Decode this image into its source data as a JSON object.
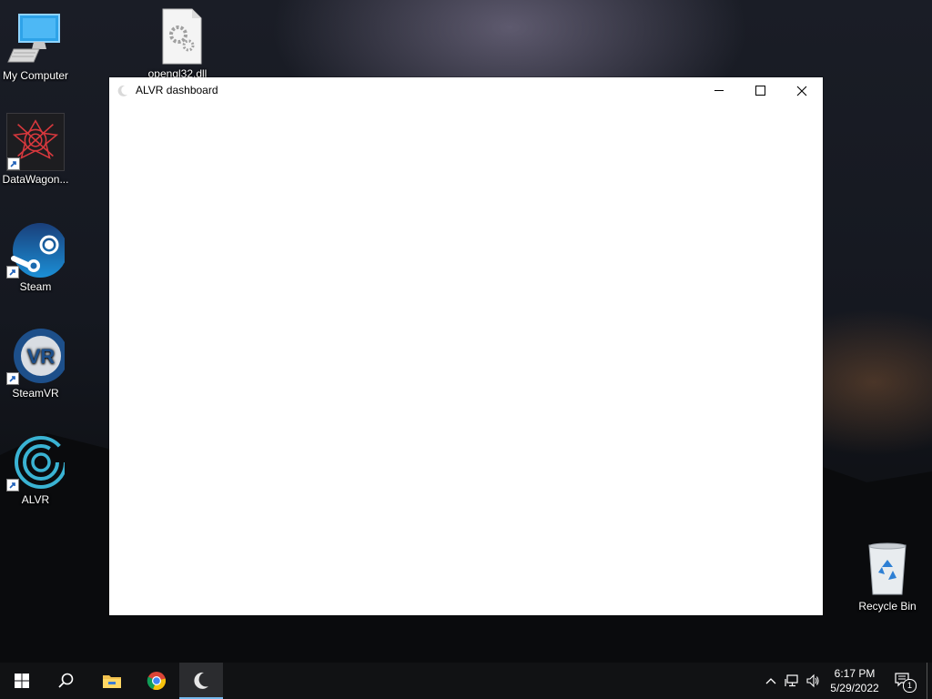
{
  "desktop": {
    "icons": [
      {
        "label": "My Computer",
        "icon": "computer-icon"
      },
      {
        "label": "opengl32.dll",
        "icon": "dll-file-icon"
      },
      {
        "label": "DataWagon...",
        "icon": "datawagon-icon"
      },
      {
        "label": "Steam",
        "icon": "steam-icon"
      },
      {
        "label": "SteamVR",
        "icon": "steamvr-icon",
        "badge": "VR"
      },
      {
        "label": "ALVR",
        "icon": "alvr-icon"
      },
      {
        "label": "Recycle Bin",
        "icon": "recycle-bin-icon"
      }
    ]
  },
  "window": {
    "title": "ALVR dashboard",
    "icon": "alvr-crescent-icon",
    "controls": [
      "minimize-icon",
      "maximize-icon",
      "close-icon"
    ]
  },
  "taskbar": {
    "items": [
      "windows-start-icon",
      "search-icon",
      "file-explorer-icon",
      "chrome-icon",
      "alvr-crescent-icon"
    ],
    "active_item": "alvr-crescent-icon",
    "tray": [
      "chevron-up-icon",
      "network-icon",
      "volume-icon"
    ],
    "time": "6:17 PM",
    "date": "5/29/2022",
    "notification_count": "1"
  },
  "colors": {
    "accent": "#76b9ed",
    "taskbar": "#111214",
    "steam_blue": "#1b5f9e",
    "alvr_cyan": "#3ab3d3",
    "datawagon_red": "#d8383d"
  }
}
